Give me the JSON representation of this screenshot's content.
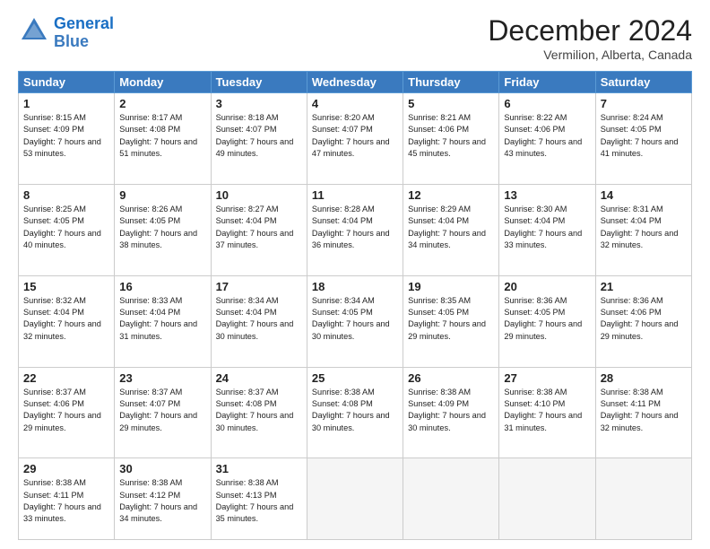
{
  "header": {
    "logo_line1": "General",
    "logo_line2": "Blue",
    "title": "December 2024",
    "subtitle": "Vermilion, Alberta, Canada"
  },
  "columns": [
    "Sunday",
    "Monday",
    "Tuesday",
    "Wednesday",
    "Thursday",
    "Friday",
    "Saturday"
  ],
  "weeks": [
    [
      {
        "day": "1",
        "sunrise": "Sunrise: 8:15 AM",
        "sunset": "Sunset: 4:09 PM",
        "daylight": "Daylight: 7 hours and 53 minutes."
      },
      {
        "day": "2",
        "sunrise": "Sunrise: 8:17 AM",
        "sunset": "Sunset: 4:08 PM",
        "daylight": "Daylight: 7 hours and 51 minutes."
      },
      {
        "day": "3",
        "sunrise": "Sunrise: 8:18 AM",
        "sunset": "Sunset: 4:07 PM",
        "daylight": "Daylight: 7 hours and 49 minutes."
      },
      {
        "day": "4",
        "sunrise": "Sunrise: 8:20 AM",
        "sunset": "Sunset: 4:07 PM",
        "daylight": "Daylight: 7 hours and 47 minutes."
      },
      {
        "day": "5",
        "sunrise": "Sunrise: 8:21 AM",
        "sunset": "Sunset: 4:06 PM",
        "daylight": "Daylight: 7 hours and 45 minutes."
      },
      {
        "day": "6",
        "sunrise": "Sunrise: 8:22 AM",
        "sunset": "Sunset: 4:06 PM",
        "daylight": "Daylight: 7 hours and 43 minutes."
      },
      {
        "day": "7",
        "sunrise": "Sunrise: 8:24 AM",
        "sunset": "Sunset: 4:05 PM",
        "daylight": "Daylight: 7 hours and 41 minutes."
      }
    ],
    [
      {
        "day": "8",
        "sunrise": "Sunrise: 8:25 AM",
        "sunset": "Sunset: 4:05 PM",
        "daylight": "Daylight: 7 hours and 40 minutes."
      },
      {
        "day": "9",
        "sunrise": "Sunrise: 8:26 AM",
        "sunset": "Sunset: 4:05 PM",
        "daylight": "Daylight: 7 hours and 38 minutes."
      },
      {
        "day": "10",
        "sunrise": "Sunrise: 8:27 AM",
        "sunset": "Sunset: 4:04 PM",
        "daylight": "Daylight: 7 hours and 37 minutes."
      },
      {
        "day": "11",
        "sunrise": "Sunrise: 8:28 AM",
        "sunset": "Sunset: 4:04 PM",
        "daylight": "Daylight: 7 hours and 36 minutes."
      },
      {
        "day": "12",
        "sunrise": "Sunrise: 8:29 AM",
        "sunset": "Sunset: 4:04 PM",
        "daylight": "Daylight: 7 hours and 34 minutes."
      },
      {
        "day": "13",
        "sunrise": "Sunrise: 8:30 AM",
        "sunset": "Sunset: 4:04 PM",
        "daylight": "Daylight: 7 hours and 33 minutes."
      },
      {
        "day": "14",
        "sunrise": "Sunrise: 8:31 AM",
        "sunset": "Sunset: 4:04 PM",
        "daylight": "Daylight: 7 hours and 32 minutes."
      }
    ],
    [
      {
        "day": "15",
        "sunrise": "Sunrise: 8:32 AM",
        "sunset": "Sunset: 4:04 PM",
        "daylight": "Daylight: 7 hours and 32 minutes."
      },
      {
        "day": "16",
        "sunrise": "Sunrise: 8:33 AM",
        "sunset": "Sunset: 4:04 PM",
        "daylight": "Daylight: 7 hours and 31 minutes."
      },
      {
        "day": "17",
        "sunrise": "Sunrise: 8:34 AM",
        "sunset": "Sunset: 4:04 PM",
        "daylight": "Daylight: 7 hours and 30 minutes."
      },
      {
        "day": "18",
        "sunrise": "Sunrise: 8:34 AM",
        "sunset": "Sunset: 4:05 PM",
        "daylight": "Daylight: 7 hours and 30 minutes."
      },
      {
        "day": "19",
        "sunrise": "Sunrise: 8:35 AM",
        "sunset": "Sunset: 4:05 PM",
        "daylight": "Daylight: 7 hours and 29 minutes."
      },
      {
        "day": "20",
        "sunrise": "Sunrise: 8:36 AM",
        "sunset": "Sunset: 4:05 PM",
        "daylight": "Daylight: 7 hours and 29 minutes."
      },
      {
        "day": "21",
        "sunrise": "Sunrise: 8:36 AM",
        "sunset": "Sunset: 4:06 PM",
        "daylight": "Daylight: 7 hours and 29 minutes."
      }
    ],
    [
      {
        "day": "22",
        "sunrise": "Sunrise: 8:37 AM",
        "sunset": "Sunset: 4:06 PM",
        "daylight": "Daylight: 7 hours and 29 minutes."
      },
      {
        "day": "23",
        "sunrise": "Sunrise: 8:37 AM",
        "sunset": "Sunset: 4:07 PM",
        "daylight": "Daylight: 7 hours and 29 minutes."
      },
      {
        "day": "24",
        "sunrise": "Sunrise: 8:37 AM",
        "sunset": "Sunset: 4:08 PM",
        "daylight": "Daylight: 7 hours and 30 minutes."
      },
      {
        "day": "25",
        "sunrise": "Sunrise: 8:38 AM",
        "sunset": "Sunset: 4:08 PM",
        "daylight": "Daylight: 7 hours and 30 minutes."
      },
      {
        "day": "26",
        "sunrise": "Sunrise: 8:38 AM",
        "sunset": "Sunset: 4:09 PM",
        "daylight": "Daylight: 7 hours and 30 minutes."
      },
      {
        "day": "27",
        "sunrise": "Sunrise: 8:38 AM",
        "sunset": "Sunset: 4:10 PM",
        "daylight": "Daylight: 7 hours and 31 minutes."
      },
      {
        "day": "28",
        "sunrise": "Sunrise: 8:38 AM",
        "sunset": "Sunset: 4:11 PM",
        "daylight": "Daylight: 7 hours and 32 minutes."
      }
    ],
    [
      {
        "day": "29",
        "sunrise": "Sunrise: 8:38 AM",
        "sunset": "Sunset: 4:11 PM",
        "daylight": "Daylight: 7 hours and 33 minutes."
      },
      {
        "day": "30",
        "sunrise": "Sunrise: 8:38 AM",
        "sunset": "Sunset: 4:12 PM",
        "daylight": "Daylight: 7 hours and 34 minutes."
      },
      {
        "day": "31",
        "sunrise": "Sunrise: 8:38 AM",
        "sunset": "Sunset: 4:13 PM",
        "daylight": "Daylight: 7 hours and 35 minutes."
      },
      null,
      null,
      null,
      null
    ]
  ]
}
